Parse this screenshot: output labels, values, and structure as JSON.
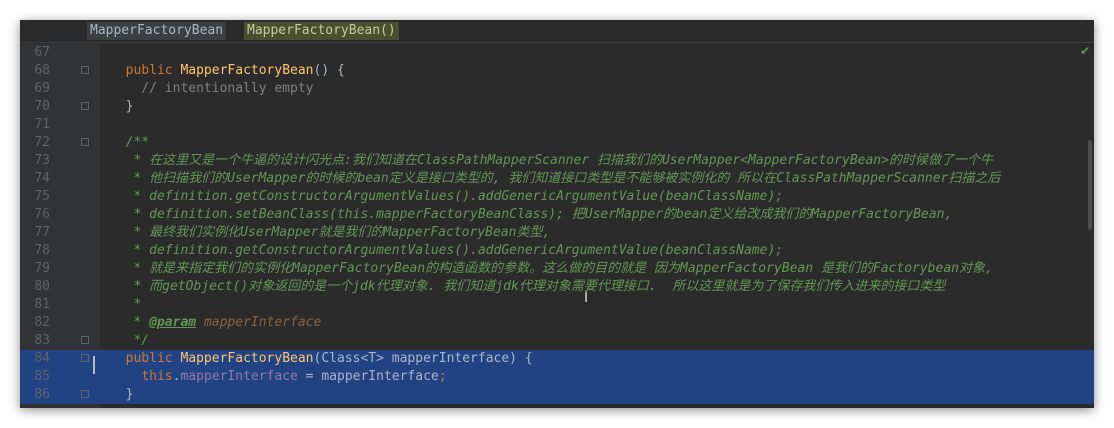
{
  "breadcrumb": [
    "MapperFactoryBean",
    "MapperFactoryBean()"
  ],
  "lines": [
    {
      "num": "67",
      "text": ""
    },
    {
      "num": "68",
      "text": "  public MapperFactoryBean() {"
    },
    {
      "num": "69",
      "text": "    // intentionally empty"
    },
    {
      "num": "70",
      "text": "  }"
    },
    {
      "num": "71",
      "text": ""
    },
    {
      "num": "72",
      "text": "  /**"
    },
    {
      "num": "73",
      "text": "   * 在这里又是一个牛逼的设计闪光点:我们知道在ClassPathMapperScanner 扫描我们的UserMapper<MapperFactoryBean>的时候做了一个牛"
    },
    {
      "num": "74",
      "text": "   * 他扫描我们的UserMapper的时候的bean定义是接口类型的, 我们知道接口类型是不能够被实例化的 所以在ClassPathMapperScanner扫描之后"
    },
    {
      "num": "75",
      "text": "   * definition.getConstructorArgumentValues().addGenericArgumentValue(beanClassName);"
    },
    {
      "num": "76",
      "text": "   * definition.setBeanClass(this.mapperFactoryBeanClass); 把UserMapper的bean定义给改成我们的MapperFactoryBean,"
    },
    {
      "num": "77",
      "text": "   * 最终我们实例化UserMapper就是我们的MapperFactoryBean类型,"
    },
    {
      "num": "78",
      "text": "   * definition.getConstructorArgumentValues().addGenericArgumentValue(beanClassName);"
    },
    {
      "num": "79",
      "text": "   * 就是来指定我们的实例化MapperFactoryBean的构造函数的参数。这么做的目的就是 因为MapperFactoryBean 是我们的Factorybean对象,"
    },
    {
      "num": "80",
      "text": "   * 而getObject()对象返回的是一个jdk代理对象. 我们知道jdk代理对象需要代理接口.  所以这里就是为了保存我们传入进来的接口类型"
    },
    {
      "num": "81",
      "text": "   *"
    },
    {
      "num": "82",
      "text": "   * @param mapperInterface"
    },
    {
      "num": "83",
      "text": "   */"
    },
    {
      "num": "84",
      "text": "  public MapperFactoryBean(Class<T> mapperInterface) {"
    },
    {
      "num": "85",
      "text": "    this.mapperInterface = mapperInterface;"
    },
    {
      "num": "86",
      "text": "  }"
    }
  ],
  "colors": {
    "background": "#2b2b2b",
    "selection": "#214283",
    "keyword": "#cc7832",
    "method": "#ffc66d",
    "javadoc": "#629755",
    "comment": "#808080",
    "field": "#9876aa"
  },
  "icons": {
    "status": "check-icon",
    "cursor": "text-cursor-icon"
  }
}
